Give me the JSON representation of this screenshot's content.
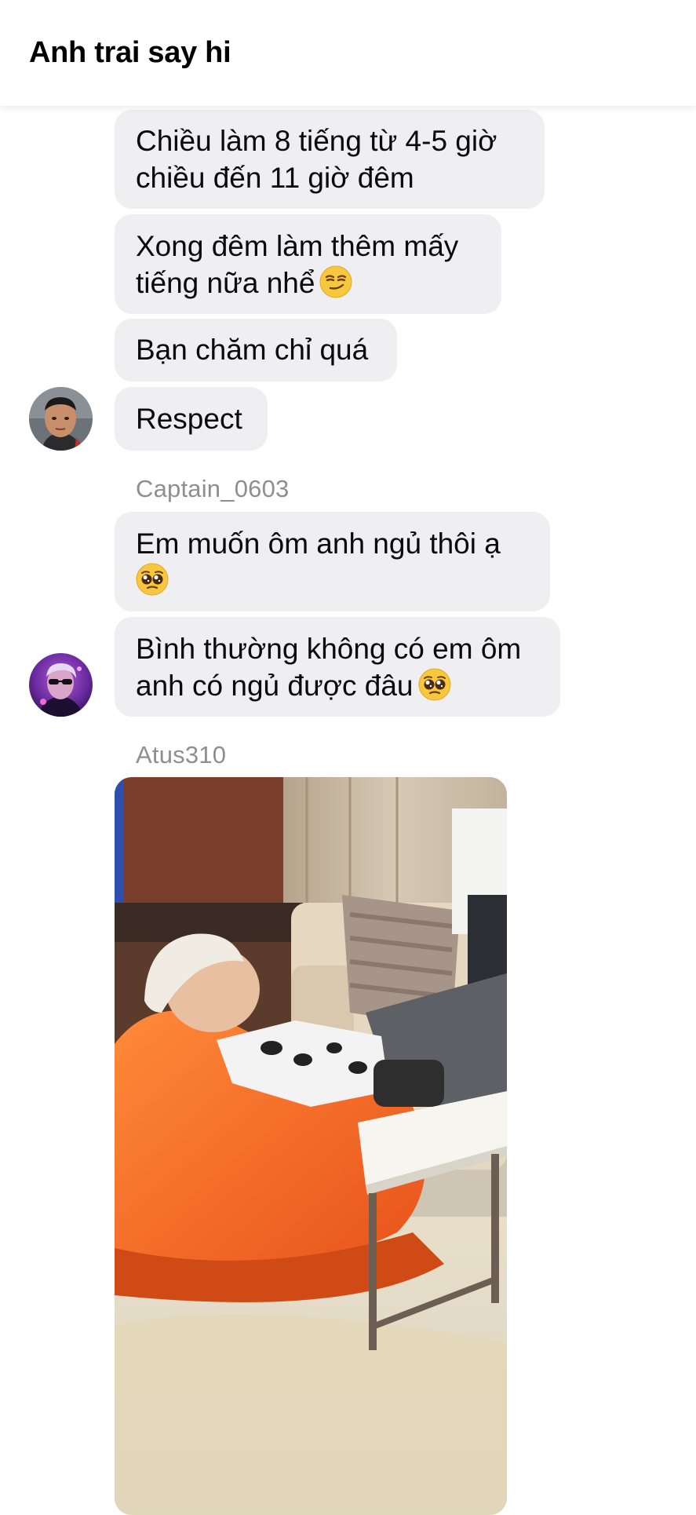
{
  "header": {
    "title": "Anh trai say hi"
  },
  "messages": [
    {
      "lines": [
        "Chiều làm 8 tiếng từ 4-5 giờ",
        "chiều đến 11 giờ đêm"
      ]
    },
    {
      "lines": [
        "Xong đêm làm thêm mấy",
        "tiếng nữa nhể"
      ],
      "emoji": "smirking-face"
    },
    {
      "lines": [
        "Bạn chăm chỉ quá"
      ]
    },
    {
      "lines": [
        "Respect"
      ]
    }
  ],
  "group2": {
    "sender": "Captain_0603",
    "messages": [
      {
        "lines": [
          "Em muốn ôm anh ngủ thôi ạ",
          ""
        ],
        "emoji": "pleading-face"
      },
      {
        "lines": [
          "Bình thường không có em ôm",
          "anh có ngủ được đâu"
        ],
        "emoji": "pleading-face"
      }
    ]
  },
  "group3": {
    "sender": "Atus310",
    "media": "video-thumbnail"
  },
  "colors": {
    "bubble": "#efeff1",
    "sender_name": "#8e8e93",
    "background": "#ffffff"
  }
}
